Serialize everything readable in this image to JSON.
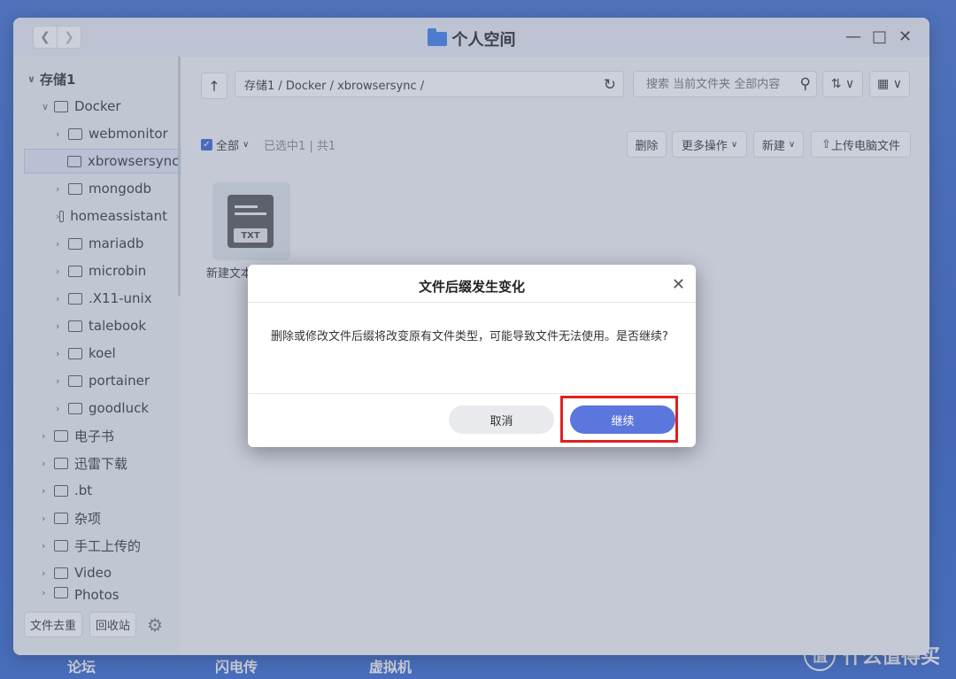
{
  "window": {
    "title": "个人空间"
  },
  "sidebar": {
    "items": [
      {
        "label": "存储1"
      },
      {
        "label": "Docker"
      },
      {
        "label": "webmonitor"
      },
      {
        "label": "xbrowsersync"
      },
      {
        "label": "mongodb"
      },
      {
        "label": "homeassistant"
      },
      {
        "label": "mariadb"
      },
      {
        "label": "microbin"
      },
      {
        "label": ".X11-unix"
      },
      {
        "label": "talebook"
      },
      {
        "label": "koel"
      },
      {
        "label": "portainer"
      },
      {
        "label": "goodluck"
      },
      {
        "label": "电子书"
      },
      {
        "label": "迅雷下载"
      },
      {
        "label": ".bt"
      },
      {
        "label": "杂项"
      },
      {
        "label": "手工上传的"
      },
      {
        "label": "Video"
      },
      {
        "label": "Photos"
      }
    ],
    "bottom": {
      "dedupe": "文件去重",
      "recycle": "回收站"
    }
  },
  "toolbar": {
    "path": "存储1 / Docker / xbrowsersync /",
    "search_placeholder": "搜索 当前文件夹 全部内容"
  },
  "actions": {
    "select_all": "全部",
    "selection_info": "已选中1 | 共1",
    "delete": "删除",
    "more": "更多操作",
    "new": "新建",
    "upload": "上传电脑文件"
  },
  "file": {
    "name": "新建文本文档.tx",
    "type": "TXT"
  },
  "dialog": {
    "title": "文件后缀发生变化",
    "message": "删除或修改文件后缀将改变原有文件类型，可能导致文件无法使用。是否继续?",
    "cancel": "取消",
    "continue": "继续"
  },
  "desktop": {
    "labels": [
      "论坛",
      "闪电传",
      "虚拟机"
    ],
    "watermark": "什么值得买"
  }
}
